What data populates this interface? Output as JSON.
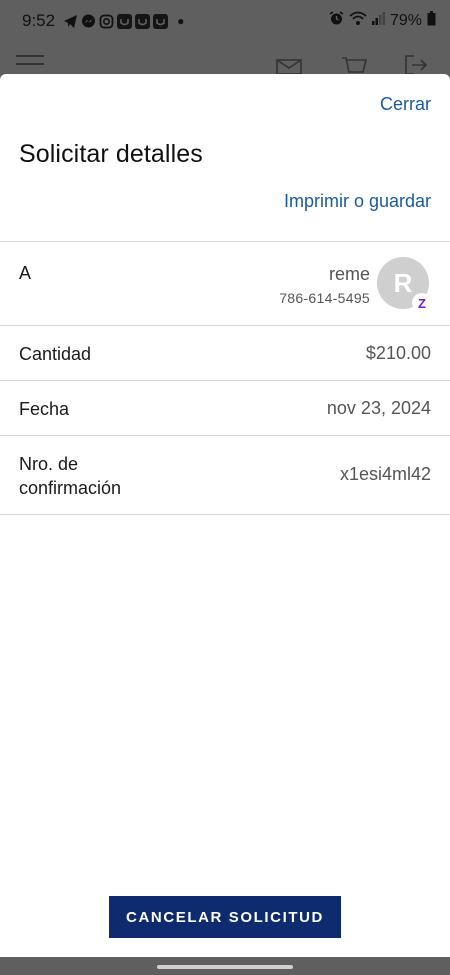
{
  "status_bar": {
    "time": "9:52",
    "battery": "79%",
    "left_icons": [
      "telegram-icon",
      "messenger-icon",
      "instagram-icon",
      "app-icon",
      "app-icon",
      "app-icon"
    ],
    "right_icons": [
      "alarm-icon",
      "wifi-icon",
      "signal-icon",
      "battery-icon"
    ]
  },
  "app_header": {
    "icons": [
      "menu-icon",
      "mail-icon",
      "cart-icon",
      "logout-icon"
    ]
  },
  "sheet": {
    "close_label": "Cerrar",
    "title": "Solicitar detalles",
    "print_label": "Imprimir o guardar",
    "to": {
      "label": "A",
      "name": "reme",
      "phone": "786-614-5495",
      "avatar_initial": "R",
      "badge": "Z"
    },
    "amount": {
      "label": "Cantidad",
      "value": "$210.00"
    },
    "date": {
      "label": "Fecha",
      "value": "nov 23, 2024"
    },
    "confirmation": {
      "label": "Nro. de confirmación",
      "value": "x1esi4ml42"
    },
    "cancel_button": "CANCELAR SOLICITUD"
  },
  "colors": {
    "accent_link": "#1a5a9a",
    "button": "#0d2b6e",
    "zelle": "#6d1ed4",
    "dim_overlay": "#5f5f5f"
  }
}
